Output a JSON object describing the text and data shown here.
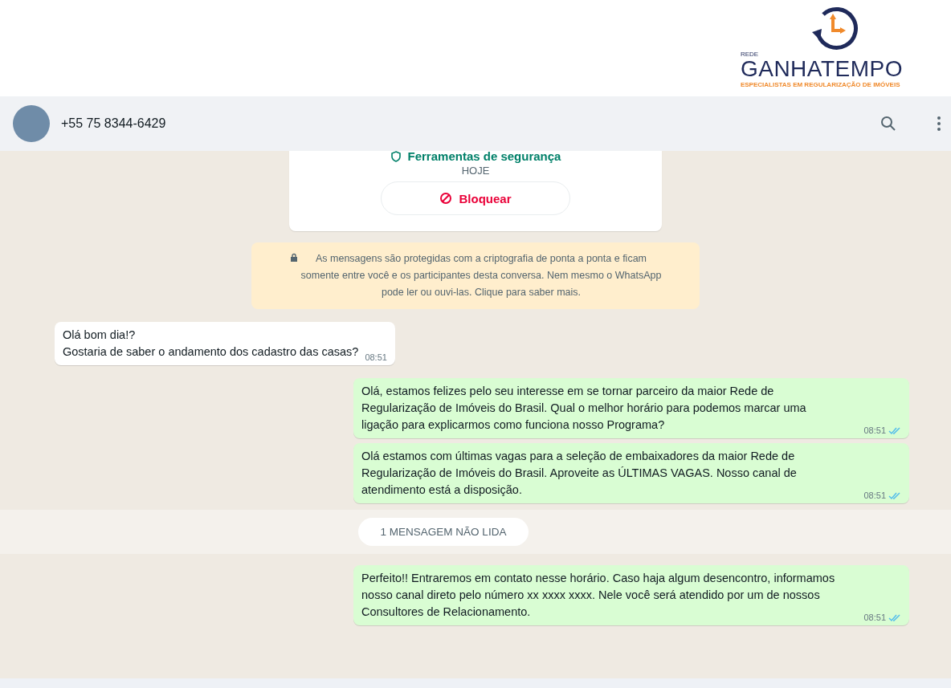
{
  "logo": {
    "small": "REDE",
    "name": "GANHATEMPO",
    "tagline": "ESPECIALISTAS EM REGULARIZAÇÃO DE IMÓVEIS"
  },
  "header": {
    "contact": "+55 75 8344-6429"
  },
  "contact_card": {
    "tools_label": "Ferramentas de segurança",
    "date_chip": "HOJE",
    "block_button": "Bloquear"
  },
  "encryption_notice": "As mensagens são protegidas com a criptografia de ponta a ponta e ficam\nsomente entre você e os participantes desta conversa. Nem mesmo o WhatsApp\npode ler ou ouvi-las. Clique para saber mais.",
  "messages": [
    {
      "kind": "incoming",
      "text": "Olá bom dia!?\nGostaria de saber o andamento dos cadastro das casas?",
      "time": "08:51",
      "read": false
    },
    {
      "kind": "outgoing",
      "text": "Olá, estamos felizes pelo seu interesse em se tornar parceiro da maior Rede de\nRegularização de Imóveis do Brasil. Qual o melhor horário para podemos marcar uma\nligação para explicarmos como funciona nosso Programa?",
      "time": "08:51",
      "read": true
    },
    {
      "kind": "outgoing",
      "text": "Olá estamos com últimas vagas para a seleção de embaixadores da maior Rede de\nRegularização de Imóveis do Brasil. Aproveite as ÚLTIMAS VAGAS. Nosso canal de\natendimento está a disposição.",
      "time": "08:51",
      "read": true
    },
    {
      "kind": "unread_divider",
      "text": "1 MENSAGEM NÃO LIDA"
    },
    {
      "kind": "outgoing",
      "text": "Perfeito!! Entraremos em contato nesse horário. Caso haja algum desencontro, informamos\nnosso canal direto pelo número xx xxxx xxxx. Nele você será atendido por um de nossos\nConsultores de Relacionamento.",
      "time": "08:51",
      "read": true
    }
  ]
}
